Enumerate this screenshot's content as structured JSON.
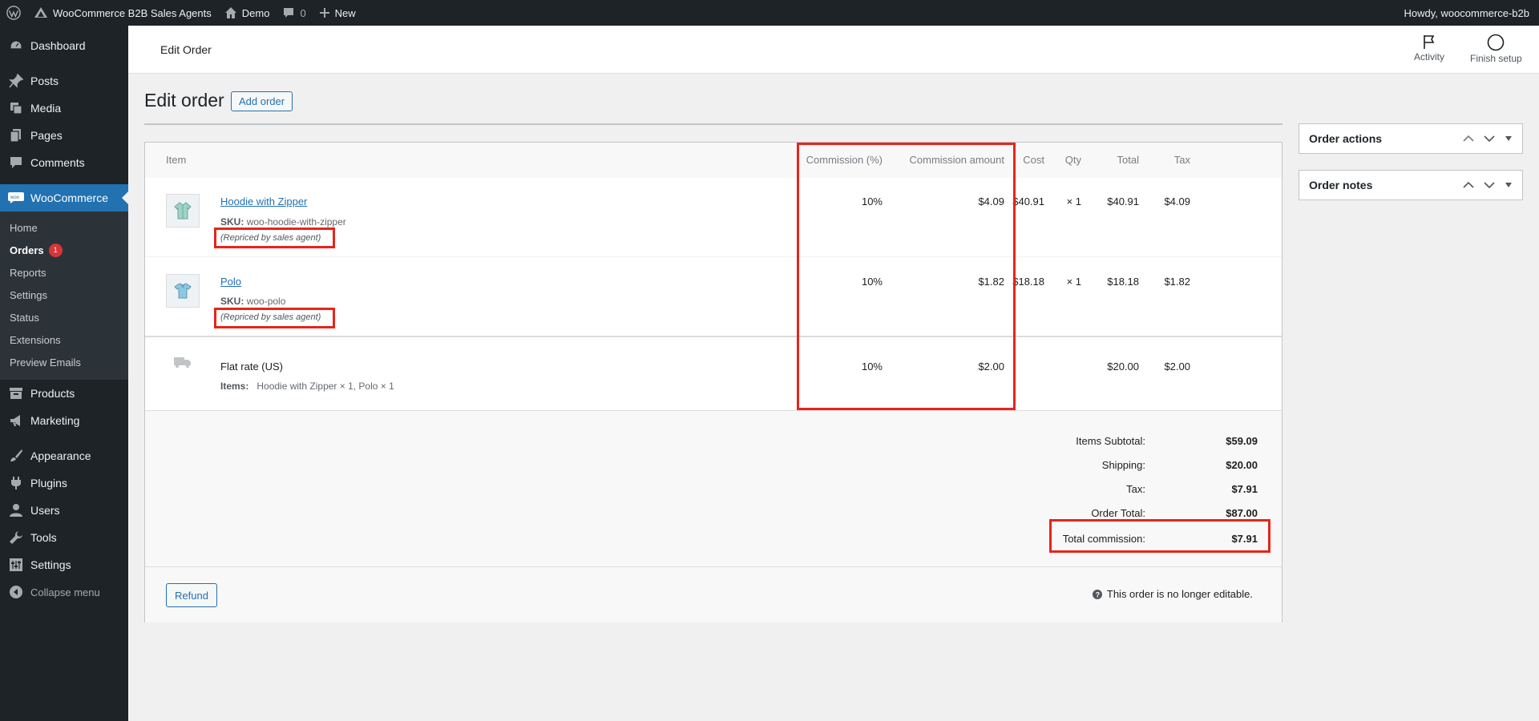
{
  "admin_bar": {
    "site_name": "WooCommerce B2B Sales Agents",
    "demo": "Demo",
    "comments_count": "0",
    "new_label": "New",
    "howdy": "Howdy, woocommerce-b2b"
  },
  "sidebar": {
    "items": [
      {
        "label": "Dashboard",
        "icon": "dashboard-icon"
      },
      {
        "label": "Posts",
        "icon": "pin-icon"
      },
      {
        "label": "Media",
        "icon": "media-icon"
      },
      {
        "label": "Pages",
        "icon": "pages-icon"
      },
      {
        "label": "Comments",
        "icon": "comment-icon"
      },
      {
        "label": "WooCommerce",
        "icon": "woo-icon"
      },
      {
        "label": "Products",
        "icon": "archive-icon"
      },
      {
        "label": "Marketing",
        "icon": "megaphone-icon"
      },
      {
        "label": "Appearance",
        "icon": "brush-icon"
      },
      {
        "label": "Plugins",
        "icon": "plugin-icon"
      },
      {
        "label": "Users",
        "icon": "user-icon"
      },
      {
        "label": "Tools",
        "icon": "wrench-icon"
      },
      {
        "label": "Settings",
        "icon": "settings-icon"
      }
    ],
    "woo_submenu": [
      "Home",
      "Orders",
      "Reports",
      "Settings",
      "Status",
      "Extensions",
      "Preview Emails"
    ],
    "orders_badge": "1",
    "collapse_label": "Collapse menu"
  },
  "header": {
    "title": "Edit Order",
    "activity": "Activity",
    "finish_setup": "Finish setup"
  },
  "page": {
    "title": "Edit order",
    "add_order": "Add order"
  },
  "table": {
    "columns": [
      "Item",
      "Commission (%)",
      "Commission amount",
      "Cost",
      "Qty",
      "Total",
      "Tax"
    ],
    "items": [
      {
        "name": "Hoodie with Zipper",
        "sku_label": "SKU:",
        "sku": "woo-hoodie-with-zipper",
        "meta": "(Repriced by sales agent)",
        "commission_pct": "10%",
        "commission_amount": "$4.09",
        "cost": "$40.91",
        "qty": "× 1",
        "total": "$40.91",
        "tax": "$4.09"
      },
      {
        "name": "Polo",
        "sku_label": "SKU:",
        "sku": "woo-polo",
        "meta": "(Repriced by sales agent)",
        "commission_pct": "10%",
        "commission_amount": "$1.82",
        "cost": "$18.18",
        "qty": "× 1",
        "total": "$18.18",
        "tax": "$1.82"
      }
    ],
    "shipping": {
      "name": "Flat rate (US)",
      "items_label": "Items:",
      "items": "Hoodie with Zipper × 1, Polo × 1",
      "commission_pct": "10%",
      "commission_amount": "$2.00",
      "total": "$20.00",
      "tax": "$2.00"
    }
  },
  "totals": {
    "items_subtotal_label": "Items Subtotal:",
    "items_subtotal": "$59.09",
    "shipping_label": "Shipping:",
    "shipping": "$20.00",
    "tax_label": "Tax:",
    "tax": "$7.91",
    "order_total_label": "Order Total:",
    "order_total": "$87.00",
    "total_commission_label": "Total commission:",
    "total_commission": "$7.91"
  },
  "footer": {
    "refund": "Refund",
    "not_editable": "This order is no longer editable."
  },
  "right_boxes": {
    "order_actions": "Order actions",
    "order_notes": "Order notes"
  },
  "colors": {
    "highlight": "#e8241a",
    "accent": "#2271b1",
    "admin_dark": "#1d2327"
  }
}
